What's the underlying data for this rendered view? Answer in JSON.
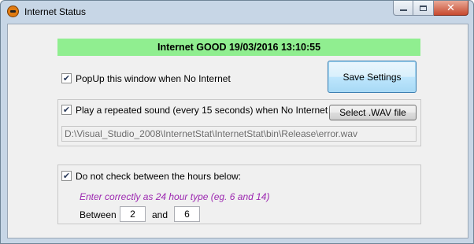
{
  "window": {
    "title": "Internet Status",
    "icon": "app-face-icon"
  },
  "status": {
    "text": "Internet GOOD 19/03/2016 13:10:55",
    "color": "#90ee90"
  },
  "popup": {
    "label": "PopUp this window when No Internet",
    "checked": true
  },
  "save_button_label": "Save Settings",
  "sound": {
    "label": "Play a repeated sound (every 15 seconds) when No Internet",
    "checked": true,
    "select_button_label": "Select .WAV file",
    "file_path": "D:\\Visual_Studio_2008\\InternetStat\\InternetStat\\bin\\Release\\error.wav"
  },
  "hours": {
    "label": "Do not check between the hours below:",
    "checked": true,
    "hint": "Enter correctly as 24 hour type (eg. 6 and 14)",
    "hint_color": "#9c27b0",
    "between_label": "Between",
    "and_label": "and",
    "start": "2",
    "end": "6"
  }
}
